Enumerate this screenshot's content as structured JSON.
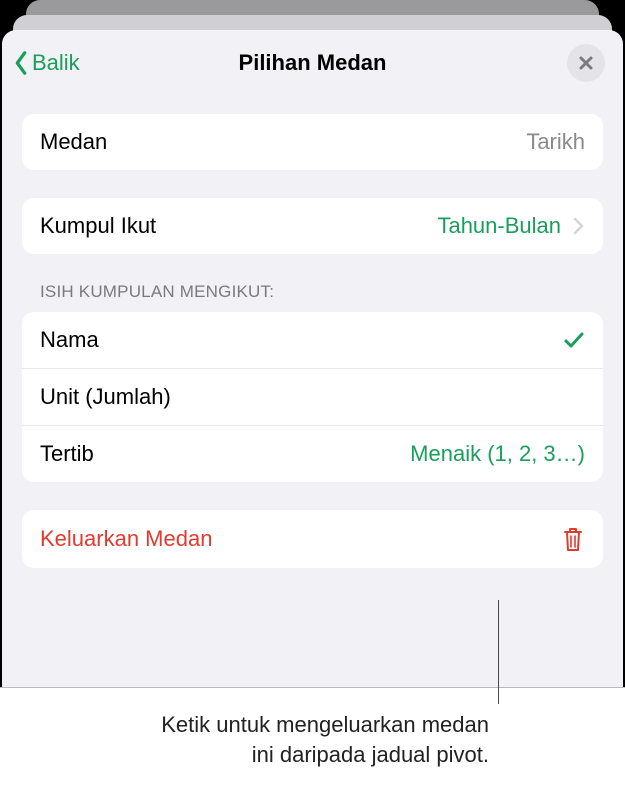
{
  "nav": {
    "back_label": "Balik",
    "title": "Pilihan Medan"
  },
  "field_row": {
    "label": "Medan",
    "value": "Tarikh"
  },
  "group_by_row": {
    "label": "Kumpul Ikut",
    "value": "Tahun-Bulan"
  },
  "sort_section_header": "ISIH KUMPULAN MENGIKUT:",
  "sort_rows": {
    "name": {
      "label": "Nama"
    },
    "unit": {
      "label": "Unit  (Jumlah)"
    },
    "order": {
      "label": "Tertib",
      "value": "Menaik (1, 2, 3…)"
    }
  },
  "remove_row": {
    "label": "Keluarkan Medan"
  },
  "annotation": {
    "line1": "Ketik untuk mengeluarkan medan",
    "line2": "ini daripada jadual pivot."
  },
  "colors": {
    "accent": "#1a9e5c",
    "destructive": "#e33a2f"
  }
}
